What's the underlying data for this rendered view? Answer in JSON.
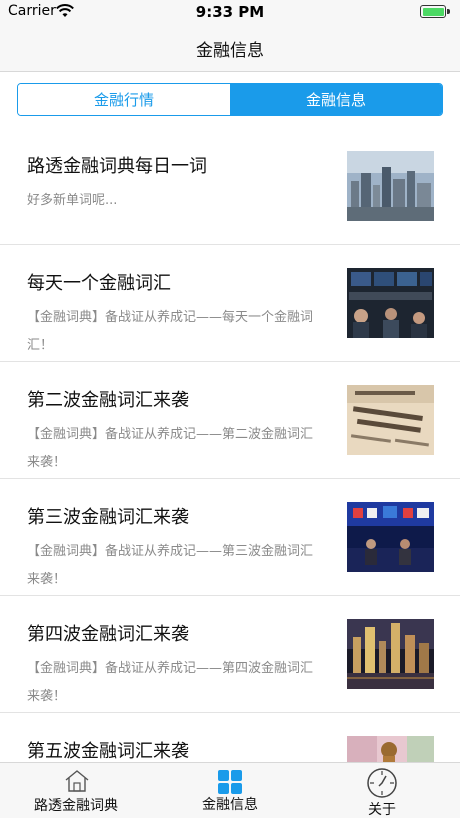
{
  "status_bar": {
    "carrier": "Carrier",
    "time": "9:33 PM"
  },
  "nav": {
    "title": "金融信息"
  },
  "segments": [
    {
      "label": "金融行情",
      "active": false
    },
    {
      "label": "金融信息",
      "active": true
    }
  ],
  "articles": [
    {
      "title": "路透金融词典每日一词",
      "desc": "好多新单词呢...",
      "image": "city-skyline-photo"
    },
    {
      "title": "每天一个金融词汇",
      "desc": "【金融词典】备战证从养成记——每天一个金融词汇！",
      "image": "stock-exchange-floor-photo"
    },
    {
      "title": "第二波金融词汇来袭",
      "desc": "【金融词典】备战证从养成记——第二波金融词汇来袭！",
      "image": "financial-times-newspaper-photo"
    },
    {
      "title": "第三波金融词汇来袭",
      "desc": "【金融词典】备战证从养成记——第三波金融词汇来袭！",
      "image": "conference-stage-photo"
    },
    {
      "title": "第四波金融词汇来袭",
      "desc": "【金融词典】备战证从养成记——第四波金融词汇来袭！",
      "image": "night-city-photo"
    },
    {
      "title": "第五波金融词汇来袭",
      "desc": "",
      "image": "chess-money-photo"
    }
  ],
  "tab_bar": {
    "items": [
      {
        "label": "路透金融词典",
        "icon": "home-icon"
      },
      {
        "label": "金融信息",
        "icon": "grid-icon",
        "active_color": "#1a9bea"
      },
      {
        "label": "关于",
        "icon": "compass-icon"
      }
    ]
  },
  "colors": {
    "accent": "#1a9bea",
    "battery": "#4cd964"
  }
}
